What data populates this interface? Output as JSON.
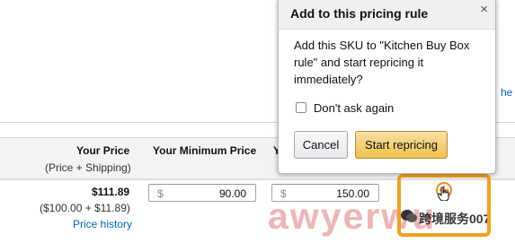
{
  "background": {
    "right_edge_link_fragment": "he"
  },
  "table": {
    "headers": {
      "your_price": "Your Price",
      "your_price_sub": "(Price + Shipping)",
      "your_minimum_price": "Your Minimum Price",
      "next_col_fragment": "Y"
    },
    "row": {
      "price": "$111.89",
      "price_breakdown": "($100.00 + $11.89)",
      "price_history_link": "Price history",
      "minimum_price": {
        "currency": "$",
        "value": "90.00"
      },
      "maximum_price": {
        "currency": "$",
        "value": "150.00"
      }
    }
  },
  "popover": {
    "title": "Add to this pricing rule",
    "close_symbol": "×",
    "body": "Add this SKU to \"Kitchen Buy Box rule\" and start repricing it immediately?",
    "checkbox_label": "Don't ask again",
    "checkbox_checked": false,
    "cancel_label": "Cancel",
    "confirm_label": "Start repricing"
  },
  "watermark": {
    "text": "awyerwu",
    "brand": "跨境服务007"
  },
  "colors": {
    "accent_orange": "#f2a01e",
    "link_blue": "#0066c0",
    "primary_button": "#f0c14b"
  }
}
